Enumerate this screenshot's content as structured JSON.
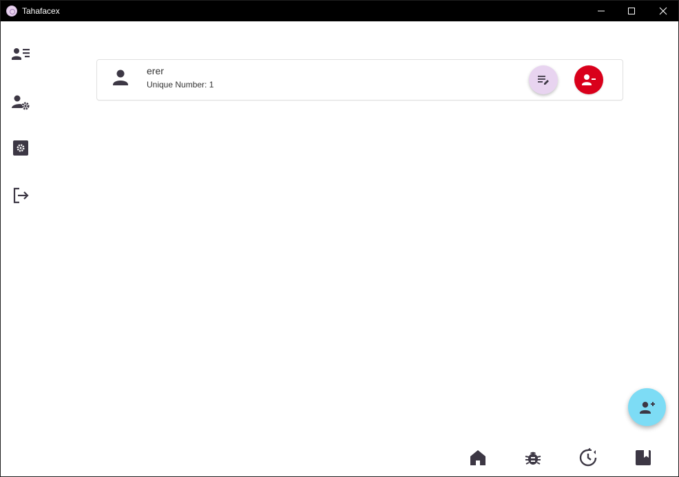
{
  "window": {
    "title": "Tahafacex"
  },
  "sidebar": {
    "items": [
      {
        "name": "contacts-list",
        "icon": "contact-list-icon"
      },
      {
        "name": "user-settings",
        "icon": "user-gear-icon"
      },
      {
        "name": "settings",
        "icon": "settings-box-icon"
      },
      {
        "name": "logout",
        "icon": "logout-icon"
      }
    ]
  },
  "records": [
    {
      "name": "erer",
      "subtitle": "Unique Number: 1"
    }
  ],
  "bottom_nav": {
    "items": [
      {
        "name": "home",
        "icon": "home-icon"
      },
      {
        "name": "bug",
        "icon": "bug-icon"
      },
      {
        "name": "history",
        "icon": "history-icon"
      },
      {
        "name": "bookmark",
        "icon": "bookmark-icon"
      }
    ]
  },
  "colors": {
    "icon": "#3c3744",
    "edit_button": "#e8d4f0",
    "remove_button": "#d9001b",
    "fab": "#7ddcf5",
    "titlebar": "#000000"
  }
}
